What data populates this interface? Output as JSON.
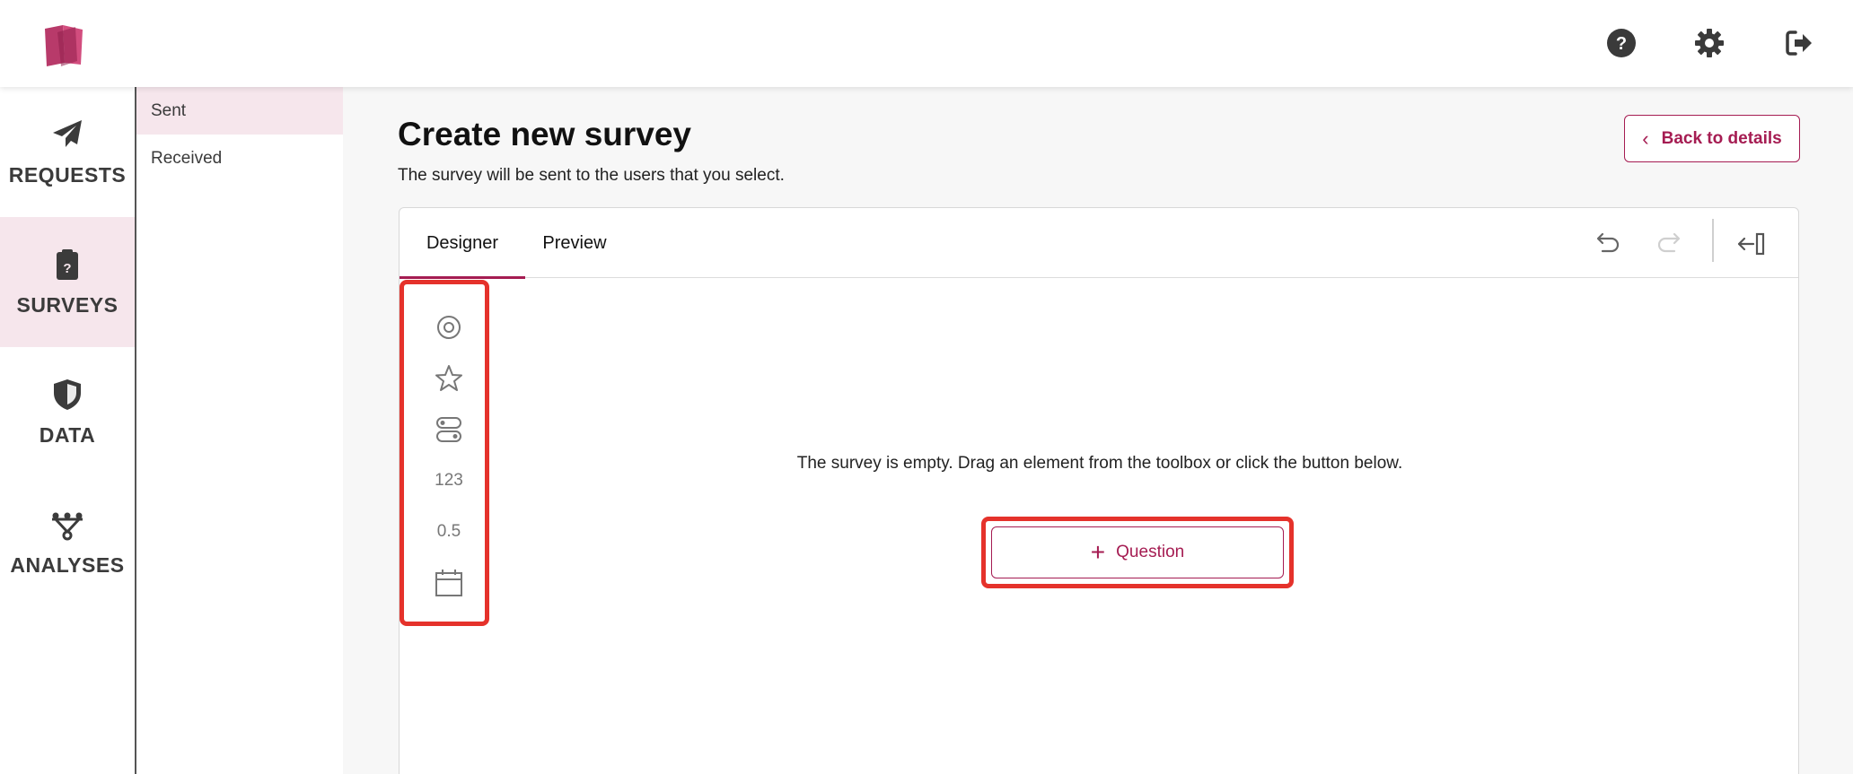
{
  "topbar": {
    "logo_icon": "book-logo-icon",
    "icons": [
      "help-icon",
      "settings-gear-icon",
      "logout-icon"
    ]
  },
  "mainnav": {
    "items": [
      {
        "label": "REQUESTS",
        "icon": "paper-plane-icon"
      },
      {
        "label": "SURVEYS",
        "icon": "clipboard-icon",
        "active": true
      },
      {
        "label": "DATA",
        "icon": "shield-icon"
      },
      {
        "label": "ANALYSES",
        "icon": "nodes-icon"
      }
    ]
  },
  "subnav": {
    "items": [
      {
        "label": "Sent",
        "active": true
      },
      {
        "label": "Received"
      }
    ]
  },
  "page": {
    "title": "Create new survey",
    "subtitle": "The survey will be sent to the users that you select.",
    "back_label": "Back to details"
  },
  "designer": {
    "tabs": [
      {
        "label": "Designer",
        "active": true
      },
      {
        "label": "Preview"
      }
    ],
    "toolbar_icons": [
      "undo-icon",
      "redo-icon",
      "collapse-panel-icon"
    ],
    "toolbox": {
      "items": [
        {
          "type": "icon",
          "icon": "radio-icon"
        },
        {
          "type": "icon",
          "icon": "star-icon"
        },
        {
          "type": "icon",
          "icon": "toggle-icon"
        },
        {
          "type": "text",
          "text": "123"
        },
        {
          "type": "text",
          "text": "0.5"
        },
        {
          "type": "icon",
          "icon": "calendar-icon"
        }
      ]
    },
    "empty_message": "The survey is empty. Drag an element from the toolbox or click the button below.",
    "question_button": "Question"
  },
  "colors": {
    "accent": "#a51c52",
    "active_bg": "#f6e6ec",
    "highlight": "#e5322b"
  }
}
